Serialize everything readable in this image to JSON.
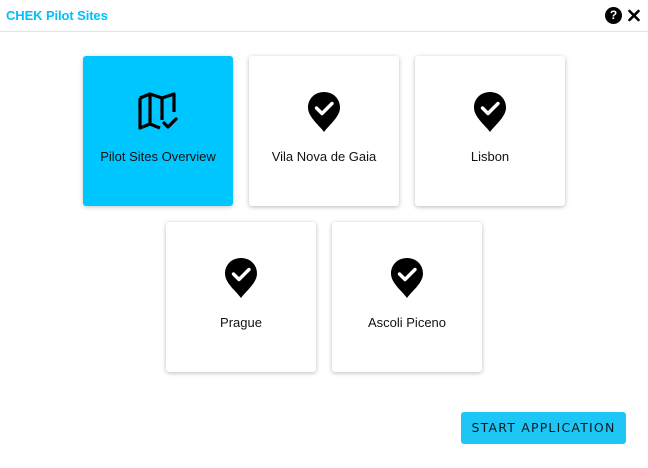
{
  "window": {
    "title": "CHEK Pilot Sites",
    "help_icon": "question-circle-icon",
    "help_glyph": "?",
    "close_icon": "close-icon"
  },
  "colors": {
    "accent": "#00bfff",
    "active_card": "#00c6ff",
    "button": "#1ec6f5"
  },
  "cards": [
    {
      "label": "Pilot Sites Overview",
      "icon": "map-check-icon",
      "selected": true
    },
    {
      "label": "Vila Nova de Gaia",
      "icon": "location-check-icon",
      "selected": false
    },
    {
      "label": "Lisbon",
      "icon": "location-check-icon",
      "selected": false
    },
    {
      "label": "Prague",
      "icon": "location-check-icon",
      "selected": false
    },
    {
      "label": "Ascoli Piceno",
      "icon": "location-check-icon",
      "selected": false
    }
  ],
  "footer": {
    "start_label": "START APPLICATION"
  }
}
